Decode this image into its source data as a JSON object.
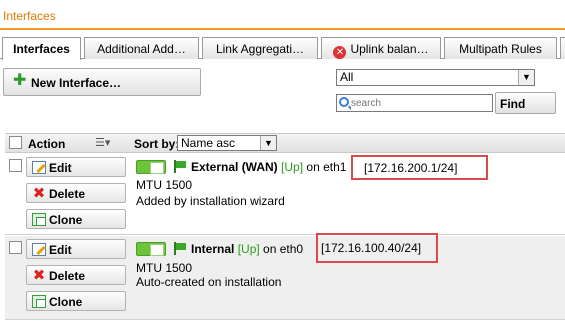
{
  "title": "Interfaces",
  "tabs": [
    {
      "label": "Interfaces",
      "active": true
    },
    {
      "label": "Additional Add…",
      "active": false
    },
    {
      "label": "Link Aggregati…",
      "active": false
    },
    {
      "label": "Uplink balan…",
      "active": false,
      "icon": "error-icon"
    },
    {
      "label": "Multipath Rules",
      "active": false
    }
  ],
  "toolbar": {
    "new_button": "New Interface…",
    "filter_value": "All",
    "search_placeholder": "search",
    "find_button": "Find"
  },
  "list_header": {
    "action_label": "Action",
    "sort_label": "Sort by:",
    "sort_value": "Name asc"
  },
  "actions": {
    "edit": "Edit",
    "delete": "Delete",
    "clone": "Clone"
  },
  "interfaces": [
    {
      "name": "External (WAN)",
      "status": "[Up]",
      "on_text": "on eth1",
      "ip": "[172.16.200.1/24]",
      "mtu": "MTU 1500",
      "comment": "Added by installation wizard"
    },
    {
      "name": "Internal",
      "status": "[Up]",
      "on_text": "on eth0",
      "ip": "[172.16.100.40/24]",
      "mtu": "MTU 1500",
      "comment": "Auto-created on installation"
    }
  ],
  "colors": {
    "accent": "#f39b25",
    "status_up": "#2e9a1e",
    "highlight": "#d94a4a"
  }
}
